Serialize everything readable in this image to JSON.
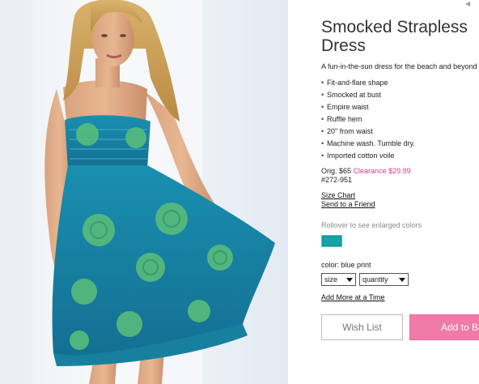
{
  "product": {
    "title": "Smocked Strapless Dress",
    "tagline": "A fun-in-the-sun dress for the beach and beyond",
    "features": [
      "Fit-and-flare shape",
      "Smocked at bust",
      "Empire waist",
      "Ruffle hem",
      "20\" from waist",
      "Machine wash. Tumble dry.",
      "Imported cotton voile"
    ],
    "original_price": "Orig. $65",
    "clearance_price": "Clearance $29.99",
    "sku": "#272-951"
  },
  "links": {
    "size_chart": "Size Chart",
    "send_to_friend": "Send to a Friend",
    "add_more": "Add More at a Time"
  },
  "colors": {
    "rollover_hint": "Rollover to see enlarged colors",
    "selected_label": "color: blue print",
    "swatch_color": "#129a9e"
  },
  "selectors": {
    "size": "size",
    "quantity": "quantity"
  },
  "buttons": {
    "wish_list": "Wish List",
    "add_to_bag": "Add to Bag"
  },
  "accent": {
    "clearance": "#d63a8b",
    "add_button": "#f07aa8"
  }
}
